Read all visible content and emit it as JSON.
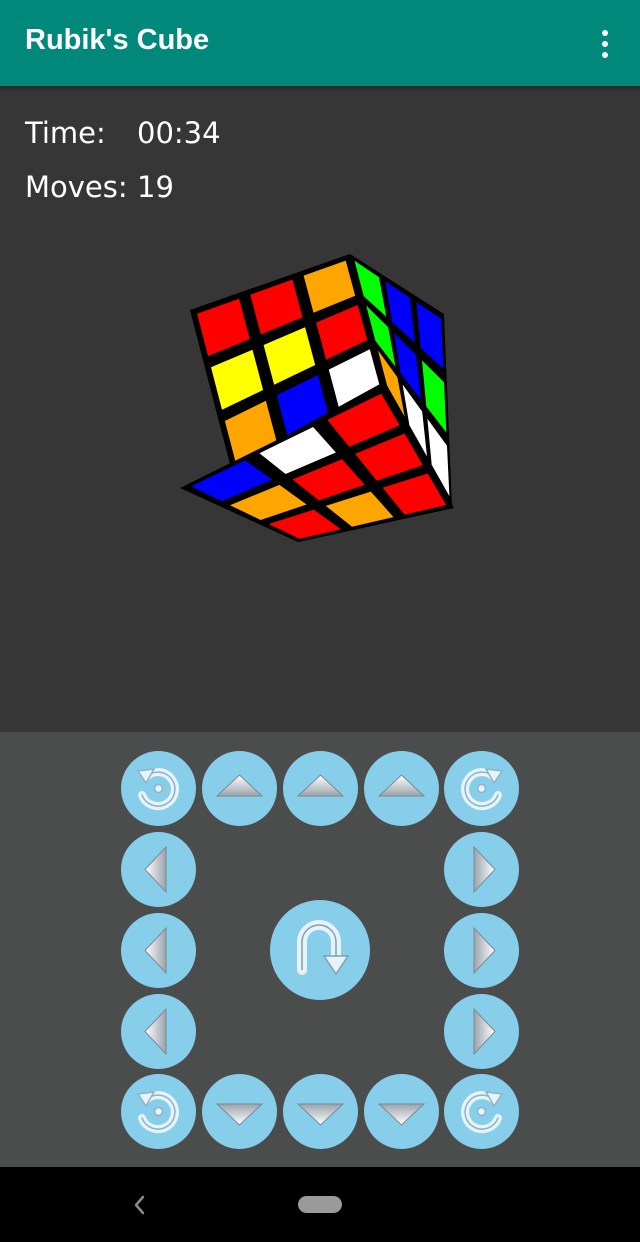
{
  "app": {
    "title": "Rubik's Cube"
  },
  "appbar": {
    "overflow_icon": "more-vert-icon"
  },
  "stats": {
    "time_label": "Time:",
    "time_value": "00:34",
    "moves_label": "Moves:",
    "moves_value": "19"
  },
  "cube": {
    "colors": {
      "red": "#ff0000",
      "yellow": "#ffff00",
      "orange": "#ffa500",
      "green": "#00ff00",
      "blue": "#0000ff",
      "white": "#ffffff",
      "sticker_border": "#000000"
    },
    "left_face": [
      [
        "red",
        "red",
        "orange"
      ],
      [
        "yellow",
        "yellow",
        "red"
      ],
      [
        "orange",
        "blue",
        "white"
      ]
    ],
    "right_face": [
      [
        "green",
        "blue",
        "blue"
      ],
      [
        "green",
        "blue",
        "green"
      ],
      [
        "orange",
        "white",
        "white"
      ]
    ],
    "bottom_face": [
      [
        "blue",
        "white",
        "red"
      ],
      [
        "orange",
        "red",
        "red"
      ],
      [
        "red",
        "orange",
        "red"
      ]
    ]
  },
  "controls": {
    "button_color": "#87ceeb",
    "top_row": [
      "rotate-ccw-icon",
      "arrow-up-icon",
      "arrow-up-icon",
      "arrow-up-icon",
      "rotate-cw-icon"
    ],
    "bottom_row": [
      "rotate-ccw-icon",
      "arrow-down-icon",
      "arrow-down-icon",
      "arrow-down-icon",
      "rotate-cw-icon"
    ],
    "left_column": [
      "arrow-left-icon",
      "arrow-left-icon",
      "arrow-left-icon"
    ],
    "right_column": [
      "arrow-right-icon",
      "arrow-right-icon",
      "arrow-right-icon"
    ],
    "center": "u-turn-icon"
  },
  "navigation_bar": {
    "back_icon": "back-icon",
    "home_icon": "home-pill-icon"
  }
}
